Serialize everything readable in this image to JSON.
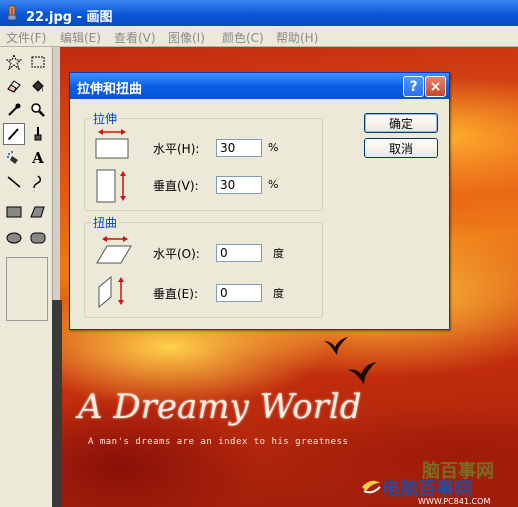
{
  "window": {
    "title": "22.jpg - 画图"
  },
  "menu": [
    {
      "label": "文件(F)"
    },
    {
      "label": "编辑(E)"
    },
    {
      "label": "查看(V)"
    },
    {
      "label": "图像(I)"
    },
    {
      "label": "颜色(C)"
    },
    {
      "label": "帮助(H)"
    }
  ],
  "toolbox": {
    "tools": [
      {
        "name": "free-form-select",
        "icon": "star-lasso-icon"
      },
      {
        "name": "rect-select",
        "icon": "dotted-rectangle-icon"
      },
      {
        "name": "eraser",
        "icon": "eraser-icon"
      },
      {
        "name": "fill",
        "icon": "paint-bucket-icon"
      },
      {
        "name": "pick-color",
        "icon": "eyedropper-icon"
      },
      {
        "name": "magnifier",
        "icon": "magnifier-icon"
      },
      {
        "name": "pencil",
        "icon": "pencil-icon",
        "selected": true
      },
      {
        "name": "brush",
        "icon": "brush-icon"
      },
      {
        "name": "airbrush",
        "icon": "airbrush-icon"
      },
      {
        "name": "text",
        "icon": "text-icon",
        "glyph": "A"
      },
      {
        "name": "line",
        "icon": "line-icon"
      },
      {
        "name": "curve",
        "icon": "curve-icon"
      },
      {
        "name": "rectangle",
        "icon": "rectangle-icon"
      },
      {
        "name": "polygon",
        "icon": "polygon-icon"
      },
      {
        "name": "ellipse",
        "icon": "ellipse-icon"
      },
      {
        "name": "rounded-rectangle",
        "icon": "rounded-rectangle-icon"
      }
    ]
  },
  "canvas": {
    "title": "A Dreamy World",
    "subtitle": "A man's dreams are an index to his greatness",
    "watermark": {
      "top": "脑百事网",
      "cn": "电脑百事网",
      "url": "WWW.PC841.COM"
    }
  },
  "dialog": {
    "title": "拉伸和扭曲",
    "help_symbol": "?",
    "close_symbol": "×",
    "stretch": {
      "legend": "拉伸",
      "horizontal_label": "水平(H):",
      "horizontal_value": "30",
      "vertical_label": "垂直(V):",
      "vertical_value": "30",
      "unit": "%"
    },
    "skew": {
      "legend": "扭曲",
      "horizontal_label": "水平(O):",
      "horizontal_value": "0",
      "vertical_label": "垂直(E):",
      "vertical_value": "0",
      "unit": "度"
    },
    "ok_label": "确定",
    "cancel_label": "取消"
  },
  "colors": {
    "title_blue": "#0a58d8",
    "dialog_face": "#ece9d8",
    "group_legend": "#0046d5",
    "arrow_red": "#d21010"
  }
}
